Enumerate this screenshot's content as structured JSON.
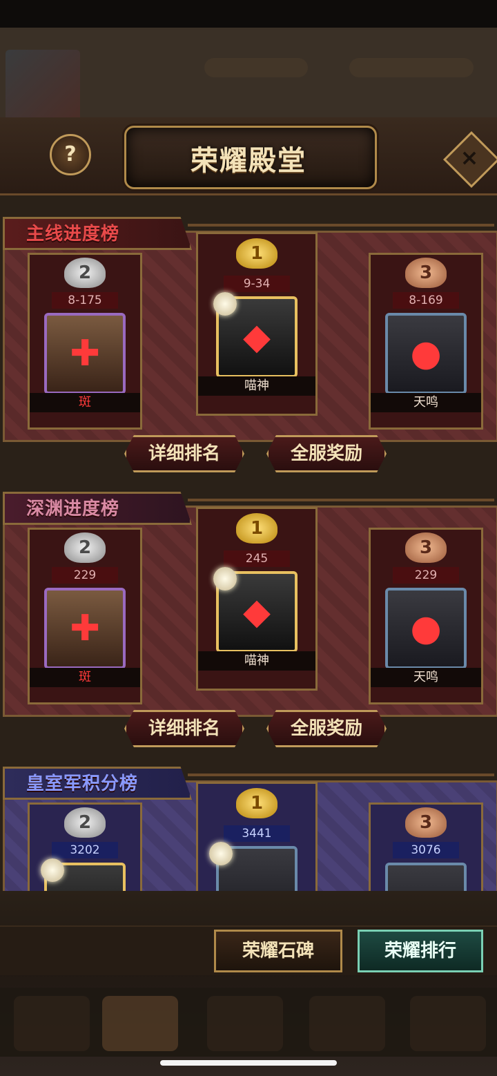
{
  "header": {
    "title": "荣耀殿堂",
    "help_label": "?",
    "close_label": "×"
  },
  "boards": [
    {
      "title": "主线进度榜",
      "first": {
        "rank": "1",
        "score": "9-34",
        "name": "喵神"
      },
      "second": {
        "rank": "2",
        "score": "8-175",
        "name": "斑"
      },
      "third": {
        "rank": "3",
        "score": "8-169",
        "name": "天鸣"
      },
      "detail_label": "详细排名",
      "reward_label": "全服奖励"
    },
    {
      "title": "深渊进度榜",
      "first": {
        "rank": "1",
        "score": "245",
        "name": "喵神"
      },
      "second": {
        "rank": "2",
        "score": "229",
        "name": "斑"
      },
      "third": {
        "rank": "3",
        "score": "229",
        "name": "天鸣"
      },
      "detail_label": "详细排名",
      "reward_label": "全服奖励"
    },
    {
      "title": "皇室军积分榜",
      "first": {
        "rank": "1",
        "score": "3441"
      },
      "second": {
        "rank": "2",
        "score": "3202"
      },
      "third": {
        "rank": "3",
        "score": "3076"
      }
    }
  ],
  "footer": {
    "stele_label": "荣耀石碑",
    "ranking_label": "荣耀排行"
  }
}
